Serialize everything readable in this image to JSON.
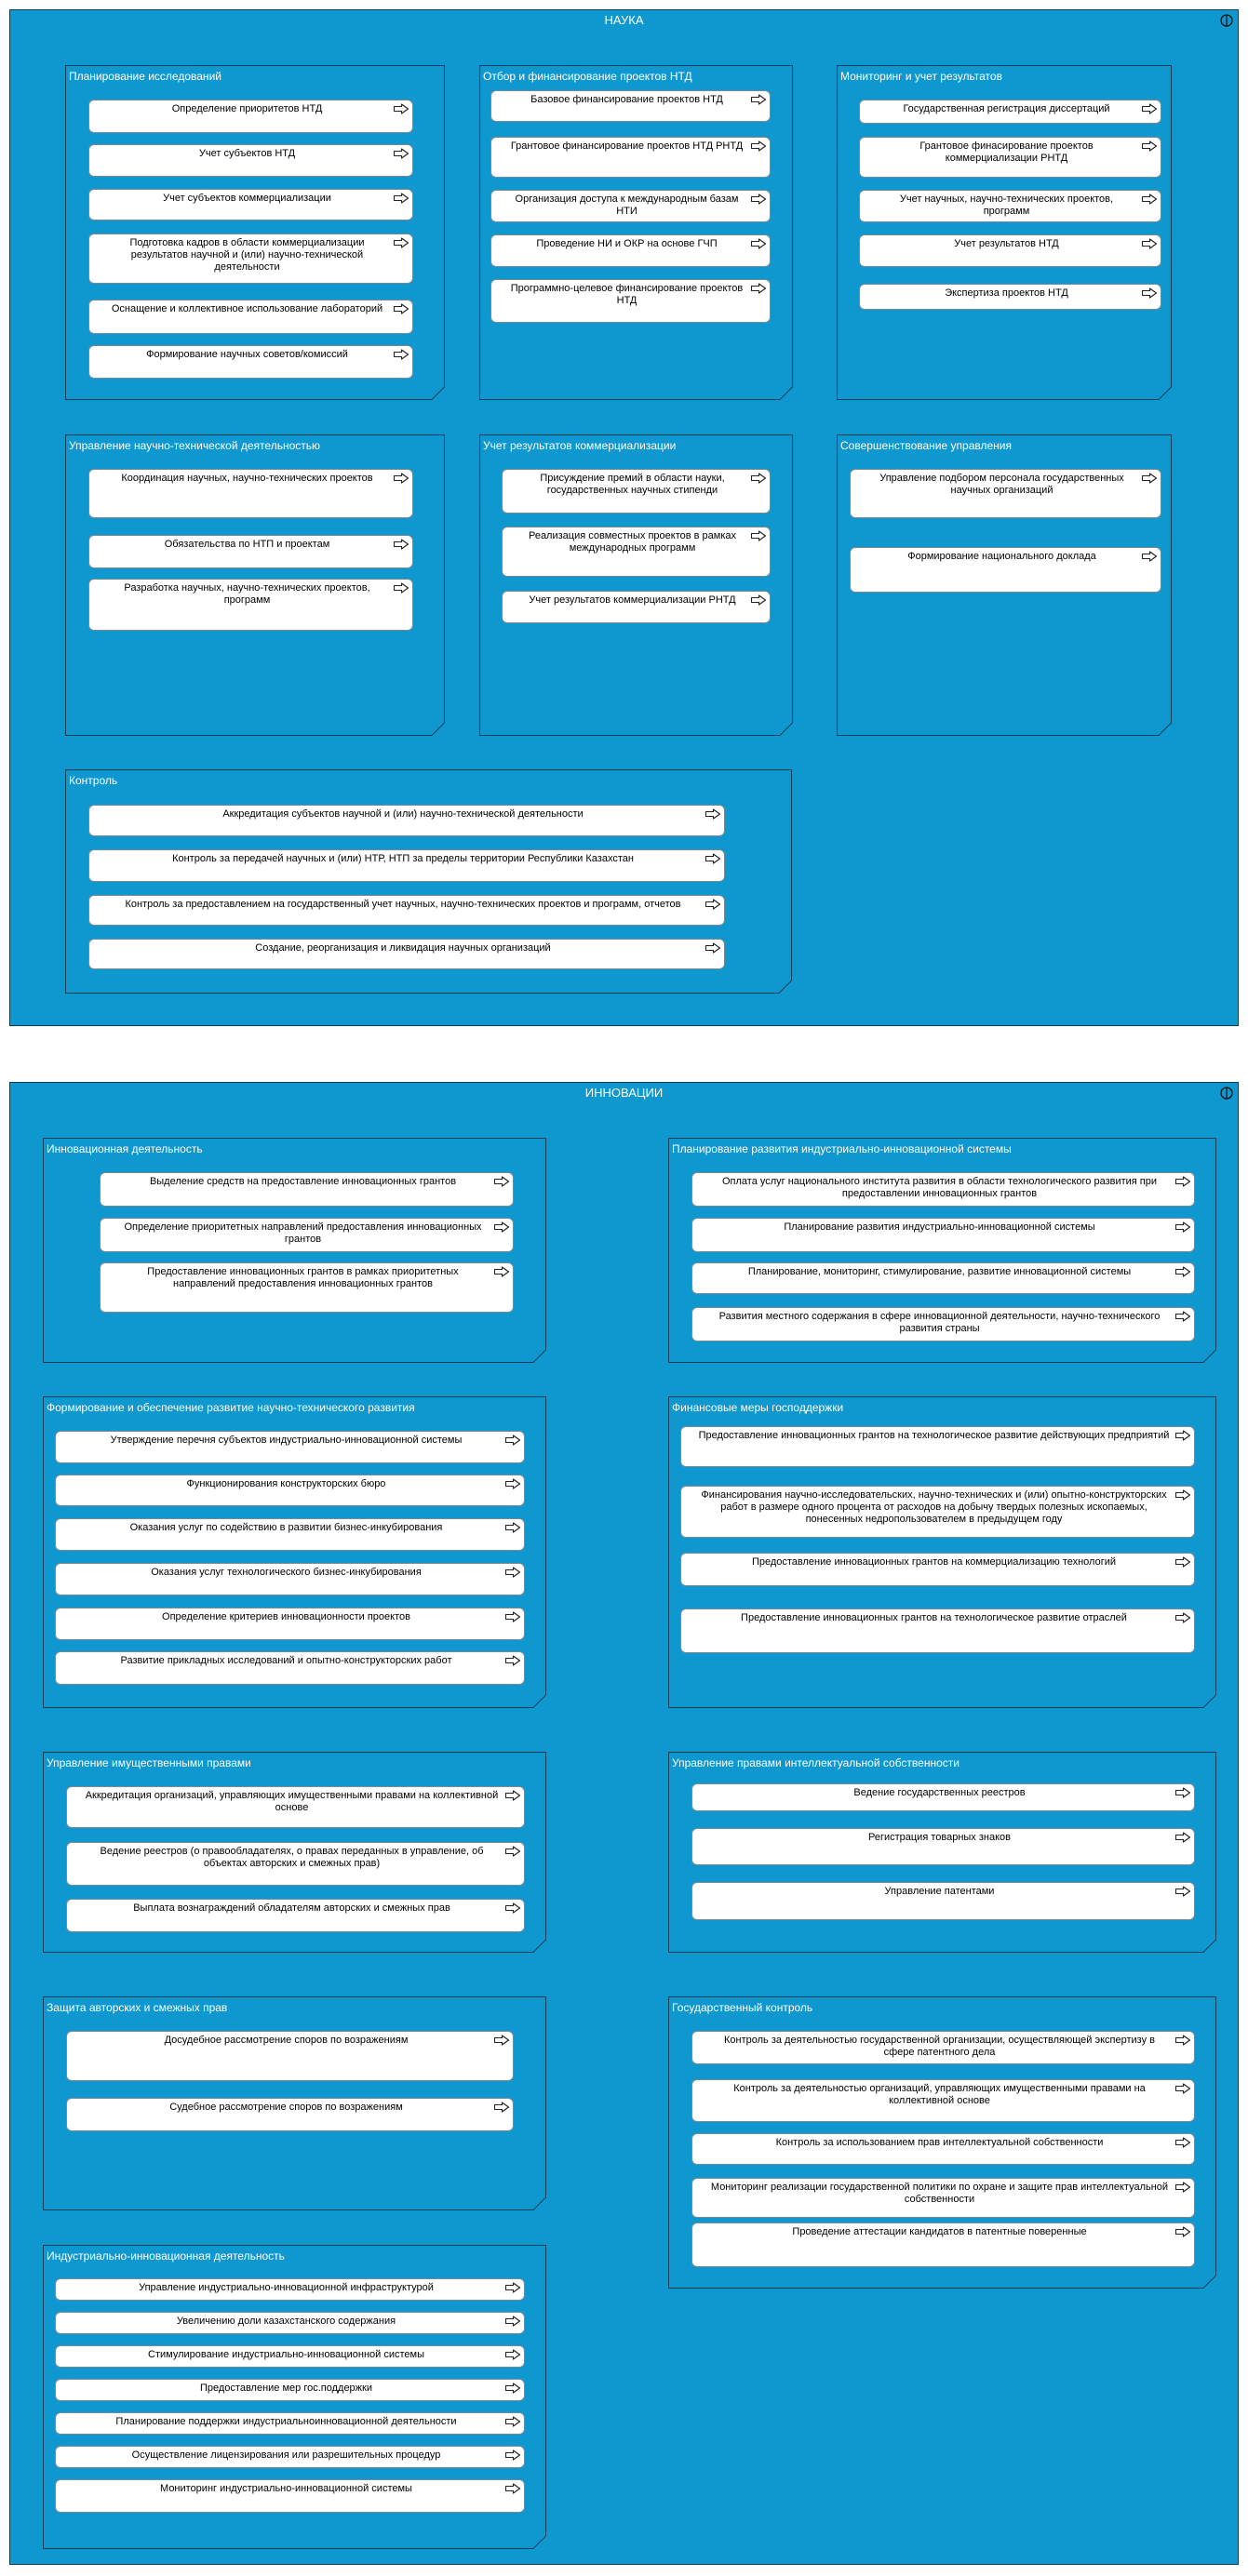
{
  "colors": {
    "background": "#0e98cf",
    "border": "#0b3f57",
    "item_fill": "#ffffff",
    "title_text": "#ffffff"
  },
  "icons": {
    "item": "arrow-right-icon",
    "header": "domain-circle-icon"
  },
  "sections": [
    {
      "title": "НАУКА",
      "groups": [
        {
          "title": "Планирование исследований",
          "items": [
            "Определение приоритетов НТД",
            "Учет субъектов НТД",
            "Учет субъектов коммерциализации",
            "Подготовка кадров в области коммерциализации результатов научной и (или) научно-технической деятельности",
            "Оснащение и коллективное использование лабораторий",
            "Формирование научных советов/комиссий"
          ]
        },
        {
          "title": "Отбор и финансирование проектов НТД",
          "items": [
            "Базовое финансирование проектов НТД",
            "Грантовое финансирование проектов НТД РНТД",
            "Организация доступа к международным базам НТИ",
            "Проведение НИ и ОКР на основе ГЧП",
            "Программно-целевое финансирование проектов НТД"
          ]
        },
        {
          "title": "Мониторинг и учет результатов",
          "items": [
            "Государственная регистрация диссертаций",
            "Грантовое финасирование проектов коммерциализации РНТД",
            "Учет научных, научно-технических проектов, программ",
            "Учет результатов НТД",
            "Экспертиза проектов НТД"
          ]
        },
        {
          "title": "Управление научно-технической деятельностью",
          "items": [
            "Координация научных, научно-технических проектов",
            "Обязательства по НТП и проектам",
            "Разработка научных, научно-технических проектов, программ"
          ]
        },
        {
          "title": "Учет результатов коммерциализации",
          "items": [
            "Присуждение премий в области науки, государственных научных стипенди",
            "Реализация совместных проектов в рамках международных программ",
            "Учет результатов коммерциализации РНТД"
          ]
        },
        {
          "title": "Совершенствование управления",
          "items": [
            "Управление подбором персонала государственных научных организаций",
            "Формирование национального доклада"
          ]
        },
        {
          "title": "Контроль",
          "items": [
            "Аккредитация субъектов научной и (или) научно-технической деятельности",
            "Контроль за передачей научных и (или) НТР, НТП за пределы территории Республики Казахстан",
            "Контроль за предоставлением на государственный учет научных, научно-технических проектов и программ, отчетов",
            "Создание, реорганизация и ликвидация научных организаций"
          ]
        }
      ]
    },
    {
      "title": "ИННОВАЦИИ",
      "groups": [
        {
          "title": "Инновационная деятельность",
          "items": [
            "Выделение  средств на предоставление инновационных грантов",
            "Определение приоритетных направлений предоставления инновационных грантов",
            "Предоставление инновационных грантов  в рамках приоритетных направлений предоставления инновационных грантов"
          ]
        },
        {
          "title": "Планирование  развития индустриально-инновационной системы",
          "items": [
            "Оплата услуг национального института развития в области технологического развития при предоставлении инновационных грантов",
            "Планирование  развития индустриально-инновационной системы",
            "Планирование, мониторинг, стимулирование, развитие инновационной системы",
            "Развития местного содержания в сфере инновационной деятельности, научно-технического развития страны"
          ]
        },
        {
          "title": "Формирование и обеспечение развитие научно-технического развития",
          "items": [
            "Утверждение перечня субъектов индустриально-инновационной системы",
            "Функционирования конструкторских бюро",
            "Оказания услуг по содействию в развитии бизнес-инкубирования",
            "Оказания услуг технологического бизнес-инкубирования",
            "Определение критериев инновационности проектов",
            "Развитие прикладных исследований и опытно-конструкторских работ"
          ]
        },
        {
          "title": "Финансовые меры господдержки",
          "items": [
            "Предоставление инновационных грантов на технологическое развитие действующих предприятий",
            "Финансирования научно-исследовательских, научно-технических и (или) опытно-конструкторских работ в размере одного процента от расходов на добычу твердых полезных ископаемых, понесенных недропользователем в предыдущем году",
            "Предоставление инновационных грантов на коммерциализацию технологий",
            "Предоставление инновационных грантов на технологическое развитие отраслей"
          ]
        },
        {
          "title": "Управление имущественными правами",
          "items": [
            "Аккредитация организаций, управляющих имущественными правами на коллективной основе",
            "Ведение реестров (о правообладателях, о правах переданных в управление, об объектах авторских и смежных прав)",
            "Выплата вознаграждений обладателям авторских и смежных прав"
          ]
        },
        {
          "title": "Управление правами интеллектуальной собственности",
          "items": [
            "Ведение государственных реестров",
            "Регистрация товарных знаков",
            "Управление патентами"
          ]
        },
        {
          "title": "Защита авторских и смежных прав",
          "items": [
            "Досудебное рассмотрение споров по возражениям",
            "Судебное рассмотрение споров по возражениям"
          ]
        },
        {
          "title": "Государственный контроль",
          "items": [
            "Контроль за деятельностью государственной организации, осуществляющей экспертизу в сфере патентного дела",
            "Контроль за деятельностью организаций, управляющих имущественными правами на коллективной основе",
            "Контроль за использованием прав интеллектуальной собственности",
            "Мониторинг реализации государственной политики по охране и защите прав интеллектуальной собственности",
            "Проведение аттестации кандидатов в патентные поверенные"
          ]
        },
        {
          "title": "Индустриально-инновационная деятельность",
          "items": [
            "Управление индустриально-инновационной инфраструктурой",
            "Увеличению доли казахстанского содержания",
            "Стимулирование индустриально-инновационной системы",
            "Предоставление мер гос.поддержки",
            "Планирование поддержки индустриальноинновационной деятельности",
            "Осуществление лицензирования или разрешительных процедур",
            "Мониторинг индустриально-инновационной системы"
          ]
        }
      ]
    }
  ]
}
